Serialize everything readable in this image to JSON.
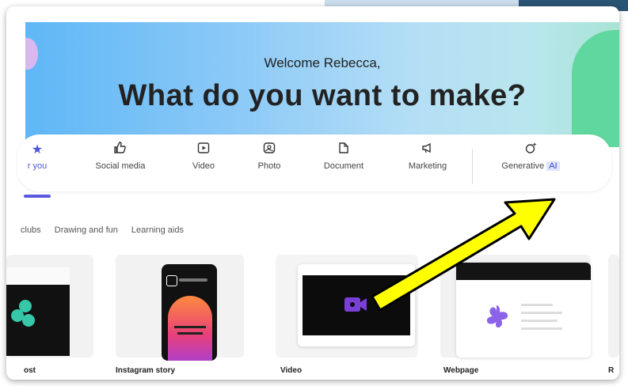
{
  "hero": {
    "welcome": "Welcome Rebecca,",
    "headline": "What do you want to make?"
  },
  "categories": [
    {
      "label": "r you",
      "icon": "star-icon",
      "active": true
    },
    {
      "label": "Social media",
      "icon": "thumbs-up-icon"
    },
    {
      "label": "Video",
      "icon": "video-icon"
    },
    {
      "label": "Photo",
      "icon": "photo-icon"
    },
    {
      "label": "Document",
      "icon": "document-icon"
    },
    {
      "label": "Marketing",
      "icon": "megaphone-icon"
    },
    {
      "label": "Generative",
      "badge": "AI",
      "icon": "sparkle-icon"
    }
  ],
  "chips": [
    "clubs",
    "Drawing and fun",
    "Learning aids"
  ],
  "templates": [
    {
      "label": "ost"
    },
    {
      "label": "Instagram story"
    },
    {
      "label": "Video"
    },
    {
      "label": "Webpage"
    },
    {
      "label": "R"
    }
  ],
  "colors": {
    "accent": "#5a59e0",
    "arrow_fill": "#ffff00",
    "hero_green": "#5fd79e",
    "hero_blue": "#5fb7f6"
  }
}
